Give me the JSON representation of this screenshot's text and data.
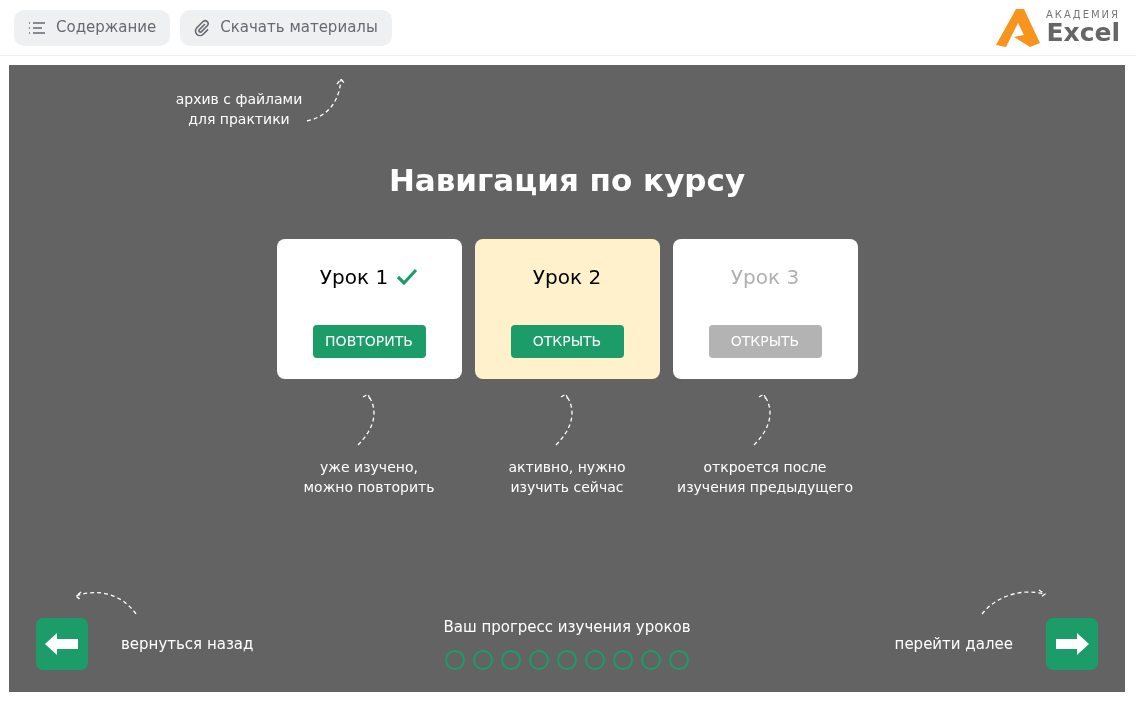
{
  "toolbar": {
    "buttons": [
      {
        "kind": "contents",
        "label": "Содержание"
      },
      {
        "kind": "materials",
        "label": "Скачать материалы"
      }
    ]
  },
  "logo": {
    "small": "АКАДЕМИЯ",
    "big": "Excel"
  },
  "slide": {
    "top_note": "архив с файлами\nдля практики",
    "title": "Навигация по курсу",
    "lessons": [
      {
        "title": "Урок 1",
        "kind": "done",
        "button": "ПОВТОРИТЬ",
        "note": "уже изучено,\nможно повторить"
      },
      {
        "title": "Урок 2",
        "kind": "active",
        "button": "ОТКРЫТЬ",
        "note": "активно, нужно\nизучить сейчас"
      },
      {
        "title": "Урок 3",
        "kind": "locked",
        "button": "ОТКРЫТЬ",
        "note": "откроется после\nизучения предыдущего"
      }
    ],
    "back_label": "вернуться назад",
    "next_label": "перейти далее",
    "progress": {
      "title": "Ваш прогресс изучения уроков",
      "dots": [
        {
          "filled": false
        },
        {
          "filled": false
        },
        {
          "filled": false
        },
        {
          "filled": false
        },
        {
          "filled": false
        },
        {
          "filled": false
        },
        {
          "filled": false
        },
        {
          "filled": false
        },
        {
          "filled": false
        }
      ]
    }
  }
}
